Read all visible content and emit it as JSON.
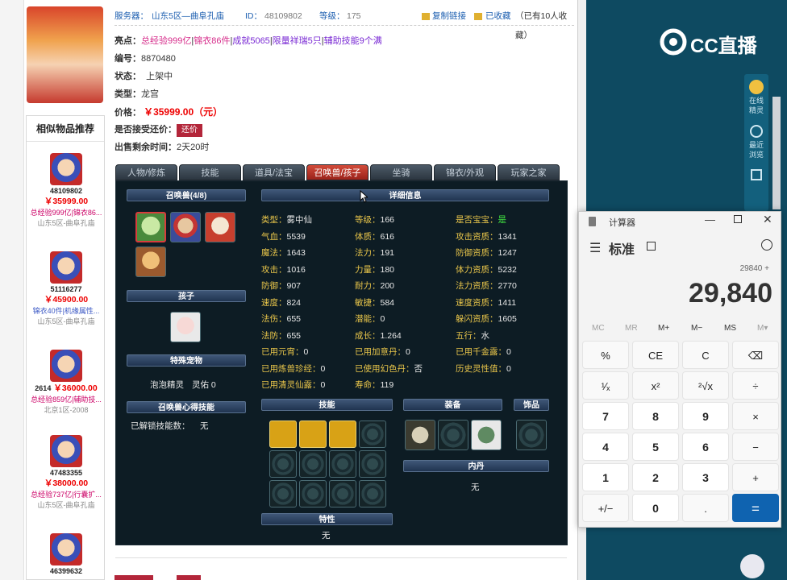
{
  "header": {
    "server_label": "服务器：",
    "server": "山东5区—曲阜孔庙",
    "id_label": "ID：",
    "id": "48109802",
    "level_label": "等级：",
    "level": "175",
    "copy_link": "复制链接",
    "favorited": "已收藏",
    "fav_count_text": "（已有10人收藏）"
  },
  "item": {
    "highlights_label": "亮点：",
    "highlights": [
      "总经验999亿",
      "锦衣86件",
      "成就5065",
      "限量祥瑞5只",
      "辅助技能9个满"
    ],
    "number_label": "编号：",
    "number": "8870480",
    "status_label": "状态：",
    "status": "上架中",
    "type_label": "类型：",
    "type": "龙宫",
    "price_label": "价格：",
    "price": "￥35999.00（元）",
    "bargain_label": "是否接受还价：",
    "bargain_button": "还价",
    "time_label": "出售剩余时间：",
    "time": "2天20时"
  },
  "similar": {
    "title": "相似物品推荐",
    "items": [
      {
        "id": "48109802",
        "price": "￥35999.00",
        "highlight": "总经验999亿|锦衣86...",
        "server": "山东5区-曲阜孔庙"
      },
      {
        "id": "51116277",
        "price": "￥45900.00",
        "highlight": "锦衣40件|机缘属性...",
        "server": "山东5区-曲阜孔庙"
      },
      {
        "id": "2614",
        "price": "￥36000.00",
        "highlight": "总经验859亿|辅助技...",
        "server": "北京1区-2008"
      },
      {
        "id": "47483355",
        "price": "￥38000.00",
        "highlight": "总经验737亿|行囊扩...",
        "server": "山东5区-曲阜孔庙"
      },
      {
        "id": "46399632",
        "price": "",
        "highlight": "",
        "server": ""
      }
    ]
  },
  "tabs": [
    "人物/修炼",
    "技能",
    "道具/法宝",
    "召唤兽/孩子",
    "坐骑",
    "锦衣/外观",
    "玩家之家"
  ],
  "active_tab": "召唤兽/孩子",
  "pets": {
    "summon_header": "召唤兽(4/8)",
    "child_header": "孩子",
    "special_pet_header": "特殊宠物",
    "special_pet_name": "泡泡精灵",
    "special_pet_stat": "灵佑  0",
    "skill_insight_header": "召唤兽心得技能",
    "skill_insight_label": "已解锁技能数：",
    "skill_insight_value": "无"
  },
  "detail": {
    "header": "详细信息",
    "attrs": [
      [
        {
          "k": "类型：",
          "v": "雾中仙"
        },
        {
          "k": "等级：",
          "v": "166"
        },
        {
          "k": "是否宝宝：",
          "v": "是",
          "green": true
        }
      ],
      [
        {
          "k": "气血：",
          "v": "5539"
        },
        {
          "k": "体质：",
          "v": "616"
        },
        {
          "k": "攻击资质：",
          "v": "1341"
        }
      ],
      [
        {
          "k": "魔法：",
          "v": "1643"
        },
        {
          "k": "法力：",
          "v": "191"
        },
        {
          "k": "防御资质：",
          "v": "1247"
        }
      ],
      [
        {
          "k": "攻击：",
          "v": "1016"
        },
        {
          "k": "力量：",
          "v": "180"
        },
        {
          "k": "体力资质：",
          "v": "5232"
        }
      ],
      [
        {
          "k": "防御：",
          "v": "907"
        },
        {
          "k": "耐力：",
          "v": "200"
        },
        {
          "k": "法力资质：",
          "v": "2770"
        }
      ],
      [
        {
          "k": "速度：",
          "v": "824"
        },
        {
          "k": "敏捷：",
          "v": "584"
        },
        {
          "k": "速度资质：",
          "v": "1411"
        }
      ],
      [
        {
          "k": "法伤：",
          "v": "655"
        },
        {
          "k": "潜能：",
          "v": "0"
        },
        {
          "k": "躲闪资质：",
          "v": "1605"
        }
      ],
      [
        {
          "k": "法防：",
          "v": "655"
        },
        {
          "k": "成长：",
          "v": "1.264"
        },
        {
          "k": "五行：",
          "v": "水"
        }
      ],
      [
        {
          "k": "已用元宵：",
          "v": "0"
        },
        {
          "k": "已用加意丹：",
          "v": "0"
        },
        {
          "k": "已用千金露：",
          "v": "0"
        }
      ],
      [
        {
          "k": "已用炼兽珍经：",
          "v": "0"
        },
        {
          "k": "已使用幻色丹：",
          "v": "否"
        },
        {
          "k": "历史灵性值：",
          "v": "0"
        }
      ],
      [
        {
          "k": "已用清灵仙露：",
          "v": "0"
        },
        {
          "k": "寿命：",
          "v": "119"
        }
      ]
    ],
    "skills_header": "技能",
    "equip_header": "装备",
    "accessory_header": "饰品",
    "core_header": "内丹",
    "core_value": "无",
    "trait_header": "特性",
    "trait_value": "无"
  },
  "right": {
    "brand": "CC直播",
    "tool_1": "在线精灵",
    "tool_2": "最近浏览"
  },
  "calculator": {
    "title": "计算器",
    "mode": "标准",
    "expression": "29840 +",
    "display": "29,840",
    "memory": [
      "MC",
      "MR",
      "M+",
      "M−",
      "MS",
      "M▾"
    ],
    "keys": [
      [
        "%",
        "CE",
        "C",
        "⌫"
      ],
      [
        "¹⁄ₓ",
        "x²",
        "²√x",
        "÷"
      ],
      [
        "7",
        "8",
        "9",
        "×"
      ],
      [
        "4",
        "5",
        "6",
        "−"
      ],
      [
        "1",
        "2",
        "3",
        "+"
      ],
      [
        "+/−",
        "0",
        ".",
        "="
      ]
    ]
  },
  "colors": {
    "accent_red": "#e00000",
    "game_bg": "#0d1c24",
    "calc_equals": "#0f63b0",
    "cc_bg": "#0e4a61"
  }
}
